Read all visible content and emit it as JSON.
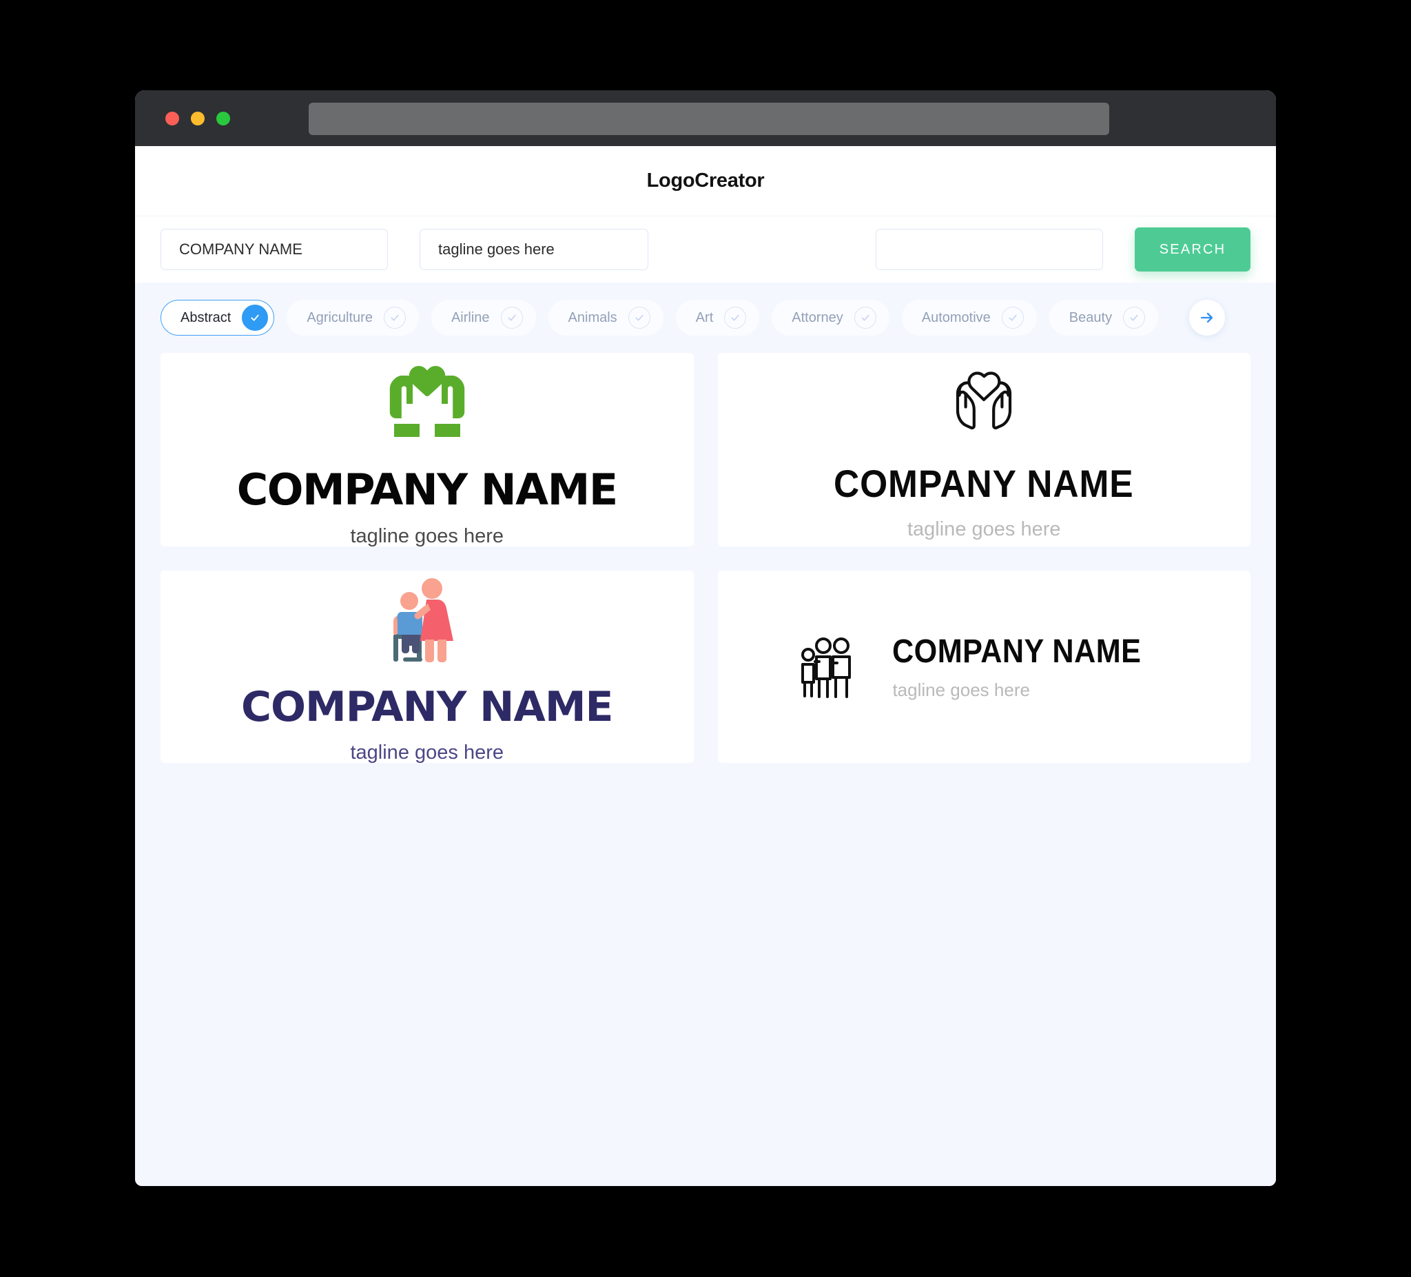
{
  "window": {
    "traffic_lights": [
      "close-red",
      "minimize-yellow",
      "maximize-green"
    ],
    "url_value": ""
  },
  "header": {
    "app_title": "LogoCreator"
  },
  "search": {
    "company_value": "COMPANY NAME",
    "company_placeholder": "COMPANY NAME",
    "tagline_value": "tagline goes here",
    "tagline_placeholder": "tagline goes here",
    "third_value": "",
    "third_placeholder": "",
    "search_button_label": "SEARCH",
    "search_button_color": "#4ecb95"
  },
  "categories": {
    "selected": "Abstract",
    "next_arrow_icon": "arrow-right-icon",
    "items": [
      {
        "label": "Abstract",
        "selected": true
      },
      {
        "label": "Agriculture",
        "selected": false
      },
      {
        "label": "Airline",
        "selected": false
      },
      {
        "label": "Animals",
        "selected": false
      },
      {
        "label": "Art",
        "selected": false
      },
      {
        "label": "Attorney",
        "selected": false
      },
      {
        "label": "Automotive",
        "selected": false
      },
      {
        "label": "Beauty",
        "selected": false
      }
    ]
  },
  "results": {
    "cards": [
      {
        "icon": "hands-holding-heart-solid-icon",
        "icon_color": "#5aad2b",
        "name": "COMPANY NAME",
        "tagline": "tagline goes here",
        "name_color": "#060606",
        "tagline_color": "#4a4a4a",
        "layout": "stacked"
      },
      {
        "icon": "hands-holding-heart-outline-icon",
        "icon_color": "#101010",
        "name": "COMPANY NAME",
        "tagline": "tagline goes here",
        "name_color": "#0a0a0a",
        "tagline_color": "#b9b9b9",
        "layout": "stacked"
      },
      {
        "icon": "caregiver-wheelchair-illustration-icon",
        "icon_color": "#f4978e",
        "name": "COMPANY NAME",
        "tagline": "tagline goes here",
        "name_color": "#2e2a66",
        "tagline_color": "#4b4786",
        "layout": "stacked"
      },
      {
        "icon": "family-group-outline-icon",
        "icon_color": "#101010",
        "name": "COMPANY NAME",
        "tagline": "tagline goes here",
        "name_color": "#0a0a0a",
        "tagline_color": "#b9b9b9",
        "layout": "horizontal"
      }
    ]
  }
}
